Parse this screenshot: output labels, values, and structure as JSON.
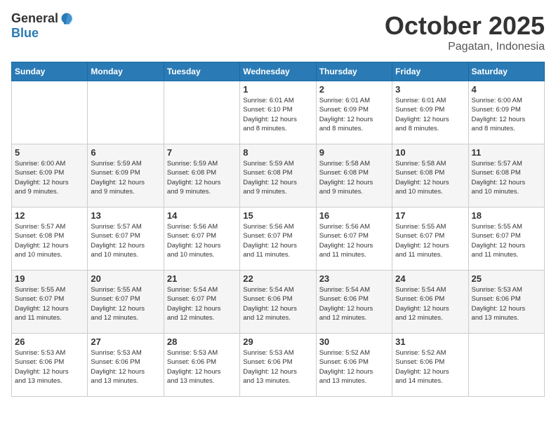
{
  "header": {
    "logo_general": "General",
    "logo_blue": "Blue",
    "month": "October 2025",
    "location": "Pagatan, Indonesia"
  },
  "weekdays": [
    "Sunday",
    "Monday",
    "Tuesday",
    "Wednesday",
    "Thursday",
    "Friday",
    "Saturday"
  ],
  "weeks": [
    [
      {
        "day": "",
        "detail": ""
      },
      {
        "day": "",
        "detail": ""
      },
      {
        "day": "",
        "detail": ""
      },
      {
        "day": "1",
        "detail": "Sunrise: 6:01 AM\nSunset: 6:10 PM\nDaylight: 12 hours\nand 8 minutes."
      },
      {
        "day": "2",
        "detail": "Sunrise: 6:01 AM\nSunset: 6:09 PM\nDaylight: 12 hours\nand 8 minutes."
      },
      {
        "day": "3",
        "detail": "Sunrise: 6:01 AM\nSunset: 6:09 PM\nDaylight: 12 hours\nand 8 minutes."
      },
      {
        "day": "4",
        "detail": "Sunrise: 6:00 AM\nSunset: 6:09 PM\nDaylight: 12 hours\nand 8 minutes."
      }
    ],
    [
      {
        "day": "5",
        "detail": "Sunrise: 6:00 AM\nSunset: 6:09 PM\nDaylight: 12 hours\nand 9 minutes."
      },
      {
        "day": "6",
        "detail": "Sunrise: 5:59 AM\nSunset: 6:09 PM\nDaylight: 12 hours\nand 9 minutes."
      },
      {
        "day": "7",
        "detail": "Sunrise: 5:59 AM\nSunset: 6:08 PM\nDaylight: 12 hours\nand 9 minutes."
      },
      {
        "day": "8",
        "detail": "Sunrise: 5:59 AM\nSunset: 6:08 PM\nDaylight: 12 hours\nand 9 minutes."
      },
      {
        "day": "9",
        "detail": "Sunrise: 5:58 AM\nSunset: 6:08 PM\nDaylight: 12 hours\nand 9 minutes."
      },
      {
        "day": "10",
        "detail": "Sunrise: 5:58 AM\nSunset: 6:08 PM\nDaylight: 12 hours\nand 10 minutes."
      },
      {
        "day": "11",
        "detail": "Sunrise: 5:57 AM\nSunset: 6:08 PM\nDaylight: 12 hours\nand 10 minutes."
      }
    ],
    [
      {
        "day": "12",
        "detail": "Sunrise: 5:57 AM\nSunset: 6:08 PM\nDaylight: 12 hours\nand 10 minutes."
      },
      {
        "day": "13",
        "detail": "Sunrise: 5:57 AM\nSunset: 6:07 PM\nDaylight: 12 hours\nand 10 minutes."
      },
      {
        "day": "14",
        "detail": "Sunrise: 5:56 AM\nSunset: 6:07 PM\nDaylight: 12 hours\nand 10 minutes."
      },
      {
        "day": "15",
        "detail": "Sunrise: 5:56 AM\nSunset: 6:07 PM\nDaylight: 12 hours\nand 11 minutes."
      },
      {
        "day": "16",
        "detail": "Sunrise: 5:56 AM\nSunset: 6:07 PM\nDaylight: 12 hours\nand 11 minutes."
      },
      {
        "day": "17",
        "detail": "Sunrise: 5:55 AM\nSunset: 6:07 PM\nDaylight: 12 hours\nand 11 minutes."
      },
      {
        "day": "18",
        "detail": "Sunrise: 5:55 AM\nSunset: 6:07 PM\nDaylight: 12 hours\nand 11 minutes."
      }
    ],
    [
      {
        "day": "19",
        "detail": "Sunrise: 5:55 AM\nSunset: 6:07 PM\nDaylight: 12 hours\nand 11 minutes."
      },
      {
        "day": "20",
        "detail": "Sunrise: 5:55 AM\nSunset: 6:07 PM\nDaylight: 12 hours\nand 12 minutes."
      },
      {
        "day": "21",
        "detail": "Sunrise: 5:54 AM\nSunset: 6:07 PM\nDaylight: 12 hours\nand 12 minutes."
      },
      {
        "day": "22",
        "detail": "Sunrise: 5:54 AM\nSunset: 6:06 PM\nDaylight: 12 hours\nand 12 minutes."
      },
      {
        "day": "23",
        "detail": "Sunrise: 5:54 AM\nSunset: 6:06 PM\nDaylight: 12 hours\nand 12 minutes."
      },
      {
        "day": "24",
        "detail": "Sunrise: 5:54 AM\nSunset: 6:06 PM\nDaylight: 12 hours\nand 12 minutes."
      },
      {
        "day": "25",
        "detail": "Sunrise: 5:53 AM\nSunset: 6:06 PM\nDaylight: 12 hours\nand 13 minutes."
      }
    ],
    [
      {
        "day": "26",
        "detail": "Sunrise: 5:53 AM\nSunset: 6:06 PM\nDaylight: 12 hours\nand 13 minutes."
      },
      {
        "day": "27",
        "detail": "Sunrise: 5:53 AM\nSunset: 6:06 PM\nDaylight: 12 hours\nand 13 minutes."
      },
      {
        "day": "28",
        "detail": "Sunrise: 5:53 AM\nSunset: 6:06 PM\nDaylight: 12 hours\nand 13 minutes."
      },
      {
        "day": "29",
        "detail": "Sunrise: 5:53 AM\nSunset: 6:06 PM\nDaylight: 12 hours\nand 13 minutes."
      },
      {
        "day": "30",
        "detail": "Sunrise: 5:52 AM\nSunset: 6:06 PM\nDaylight: 12 hours\nand 13 minutes."
      },
      {
        "day": "31",
        "detail": "Sunrise: 5:52 AM\nSunset: 6:06 PM\nDaylight: 12 hours\nand 14 minutes."
      },
      {
        "day": "",
        "detail": ""
      }
    ]
  ]
}
